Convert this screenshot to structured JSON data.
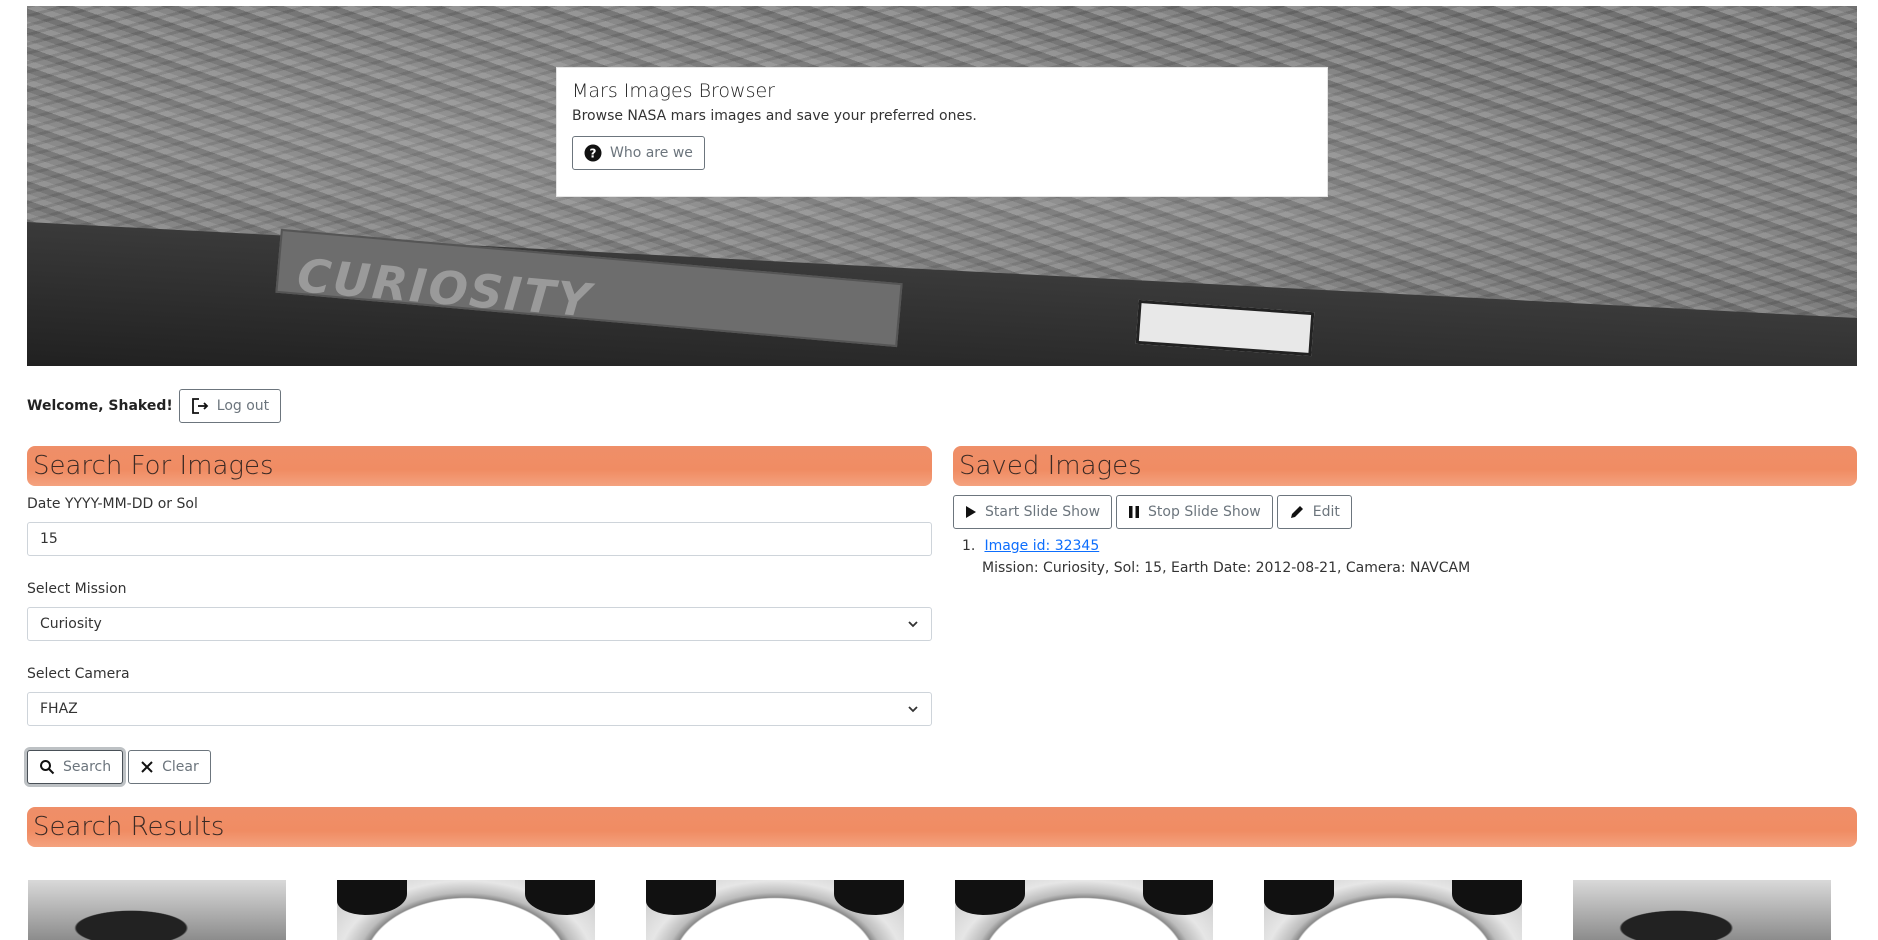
{
  "hero": {
    "title": "Mars Images Browser",
    "subtitle": "Browse NASA mars images and save your preferred ones.",
    "who_button": "Who are we",
    "background_text": "CURIOSITY"
  },
  "user": {
    "welcome": "Welcome, Shaked!",
    "logout_label": "Log out"
  },
  "search": {
    "header": "Search For Images",
    "date_label": "Date YYYY-MM-DD or Sol",
    "date_value": "15",
    "mission_label": "Select Mission",
    "mission_value": "Curiosity",
    "camera_label": "Select Camera",
    "camera_value": "FHAZ",
    "search_label": "Search",
    "clear_label": "Clear"
  },
  "saved": {
    "header": "Saved Images",
    "start_label": "Start Slide Show",
    "stop_label": "Stop Slide Show",
    "edit_label": "Edit",
    "items": [
      {
        "number": "1.",
        "link": "Image id: 32345",
        "description": "Mission: Curiosity, Sol: 15, Earth Date: 2012-08-21, Camera: NAVCAM"
      }
    ]
  },
  "results": {
    "header": "Search Results"
  },
  "colors": {
    "section_header": "#f08c63",
    "link": "#0d6efd"
  }
}
